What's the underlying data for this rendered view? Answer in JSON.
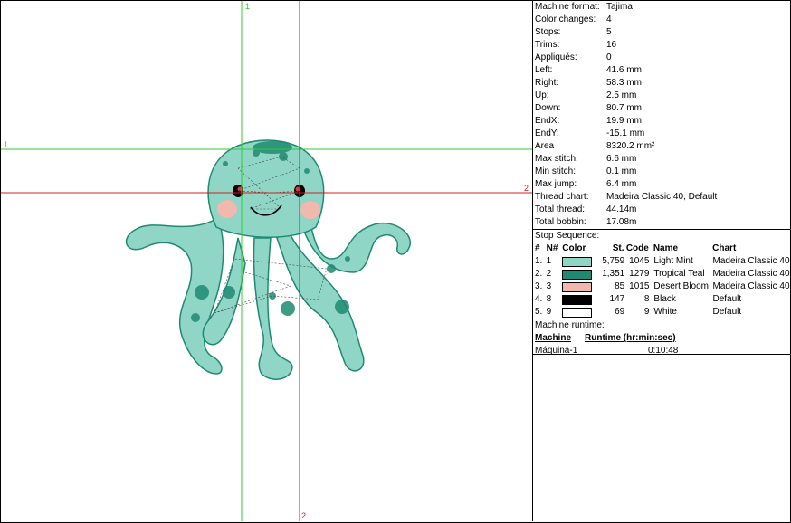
{
  "guides": {
    "v1": "1",
    "h1": "1",
    "h2": "2",
    "v2": "2"
  },
  "stats": [
    {
      "label": "Machine format:",
      "value": "Tajima"
    },
    {
      "label": "Color changes:",
      "value": "4"
    },
    {
      "label": "Stops:",
      "value": "5"
    },
    {
      "label": "Trims:",
      "value": "16"
    },
    {
      "label": "Appliqués:",
      "value": "0"
    },
    {
      "label": "Left:",
      "value": "41.6 mm"
    },
    {
      "label": "Right:",
      "value": "58.3 mm"
    },
    {
      "label": "Up:",
      "value": "2.5 mm"
    },
    {
      "label": "Down:",
      "value": "80.7 mm"
    },
    {
      "label": "EndX:",
      "value": "19.9 mm"
    },
    {
      "label": "EndY:",
      "value": "-15.1 mm"
    },
    {
      "label": "Area",
      "value": "8320.2 mm²"
    },
    {
      "label": "Max stitch:",
      "value": "6.6 mm"
    },
    {
      "label": "Min stitch:",
      "value": "0.1 mm"
    },
    {
      "label": "Max jump:",
      "value": "6.4 mm"
    },
    {
      "label": "Thread chart:",
      "value": "Madeira Classic 40, Default"
    },
    {
      "label": "Total thread:",
      "value": "44.14m"
    },
    {
      "label": "Total bobbin:",
      "value": "17.08m"
    }
  ],
  "stop_sequence": {
    "title": "Stop Sequence:",
    "headers": {
      "num": "#",
      "n": "N#",
      "color": "Color",
      "st": "St.",
      "code": "Code",
      "name": "Name",
      "chart": "Chart"
    },
    "rows": [
      {
        "num": "1.",
        "n": "1",
        "color": "#8fd6c6",
        "st": "5,759",
        "code": "1045",
        "name": "Light Mint",
        "chart": "Madeira Classic 40"
      },
      {
        "num": "2.",
        "n": "2",
        "color": "#1f8a72",
        "st": "1,351",
        "code": "1279",
        "name": "Tropical Teal",
        "chart": "Madeira Classic 40"
      },
      {
        "num": "3.",
        "n": "3",
        "color": "#f2b7ad",
        "st": "85",
        "code": "1015",
        "name": "Desert Bloom",
        "chart": "Madeira Classic 40"
      },
      {
        "num": "4.",
        "n": "8",
        "color": "#000000",
        "st": "147",
        "code": "8",
        "name": "Black",
        "chart": "Default"
      },
      {
        "num": "5.",
        "n": "9",
        "color": "#ffffff",
        "st": "69",
        "code": "9",
        "name": "White",
        "chart": "Default"
      }
    ]
  },
  "runtime": {
    "title": "Machine runtime:",
    "headers": {
      "machine": "Machine",
      "runtime": "Runtime (hr:min:sec)"
    },
    "rows": [
      {
        "machine": "Máquina-1",
        "runtime": "0:10:48"
      }
    ]
  },
  "colors": {
    "guide_green": "#33cc33",
    "guide_red": "#cc2222",
    "body": "#8fd6c6",
    "spot": "#1f8a72",
    "cheek": "#f2b7ad"
  }
}
